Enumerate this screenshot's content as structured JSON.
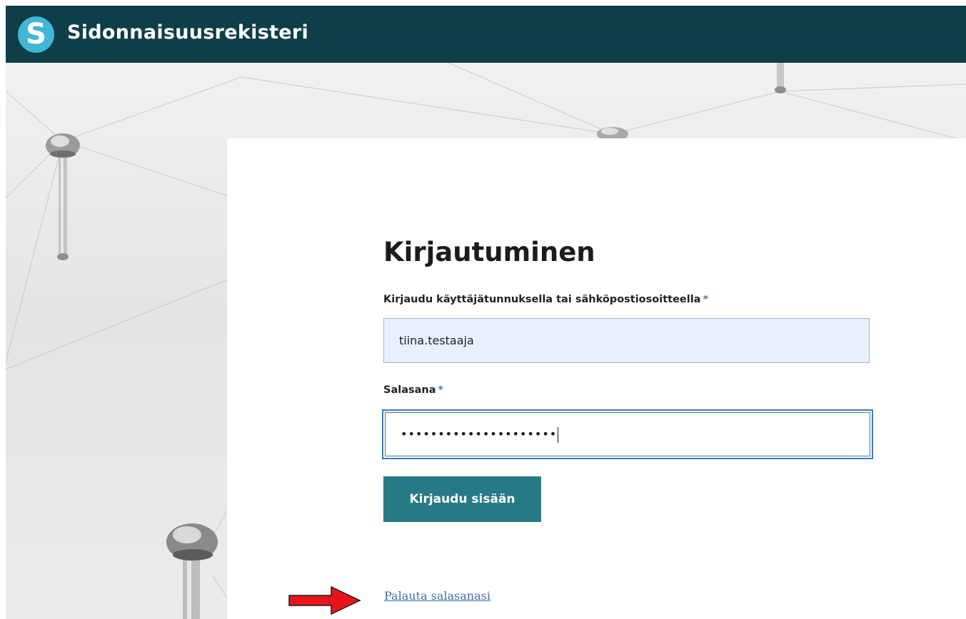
{
  "header": {
    "logo_letter": "S",
    "title": "Sidonnaisuusrekisteri"
  },
  "login": {
    "title": "Kirjautuminen",
    "username_label": "Kirjaudu käyttäjätunnuksella tai sähköpostiosoitteella",
    "username_value": "tiina.testaaja",
    "password_label": "Salasana",
    "password_value": "•••••••••••••••••••••",
    "required_marker": "*",
    "submit_label": "Kirjaudu sisään",
    "reset_link": "Palauta salasanasi"
  },
  "colors": {
    "header_bg": "#0e3e47",
    "logo_badge": "#41b6d6",
    "button_bg": "#297a89",
    "focus_border": "#3f7cb4",
    "link": "#3d6fa6",
    "annotation_arrow": "#e8141b"
  }
}
